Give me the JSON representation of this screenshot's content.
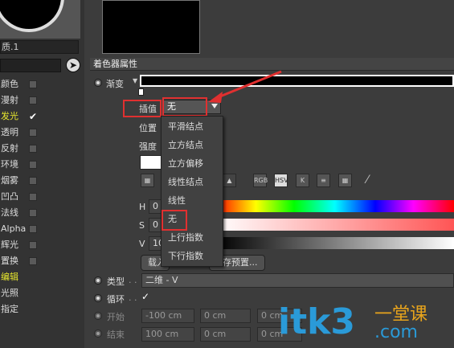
{
  "material": {
    "name": "质.1"
  },
  "channels": [
    {
      "label": "颜色",
      "checked": false
    },
    {
      "label": "漫射",
      "checked": false
    },
    {
      "label": "发光",
      "checked": true,
      "selected": true
    },
    {
      "label": "透明",
      "checked": false
    },
    {
      "label": "反射",
      "checked": false
    },
    {
      "label": "环境",
      "checked": false
    },
    {
      "label": "烟雾",
      "checked": false
    },
    {
      "label": "凹凸",
      "checked": false
    },
    {
      "label": "法线",
      "checked": false
    },
    {
      "label": "Alpha",
      "checked": false
    },
    {
      "label": "辉光",
      "checked": false
    },
    {
      "label": "置换",
      "checked": false
    },
    {
      "label": "编辑",
      "selected": true
    },
    {
      "label": "光照"
    },
    {
      "label": "指定"
    }
  ],
  "section_title": "着色器属性",
  "gradient": {
    "label": "渐变",
    "interp_label": "插值",
    "interp_value": "无",
    "position_label": "位置",
    "intensity_label": "强度"
  },
  "interp_menu": {
    "items": [
      "平滑结点",
      "立方结点",
      "立方偏移",
      "线性结点",
      "线性",
      "无",
      "上行指数",
      "下行指数"
    ]
  },
  "color_modes": [
    "RGB",
    "HSV",
    "K"
  ],
  "hsv": [
    {
      "label": "H",
      "value": "0"
    },
    {
      "label": "S",
      "value": "0"
    },
    {
      "label": "V",
      "value": "10"
    }
  ],
  "buttons": {
    "load": "载入",
    "save_preset": "存预置..."
  },
  "type": {
    "label": "类型",
    "value": "二维 - V"
  },
  "cycle": {
    "label": "循环",
    "checked": true
  },
  "start": {
    "label": "开始",
    "x": "-100 cm",
    "y": "0 cm",
    "z": "0 cm"
  },
  "end": {
    "label": "结束",
    "x": "100 cm",
    "y": "0 cm",
    "z": "0 cm"
  },
  "watermark": {
    "brand": "itk3",
    "domain": ".com",
    "cn": "一堂课"
  },
  "colors": {
    "highlight": "#e6e62e",
    "annotation": "#e03030",
    "bg": "#3c3c3c"
  }
}
